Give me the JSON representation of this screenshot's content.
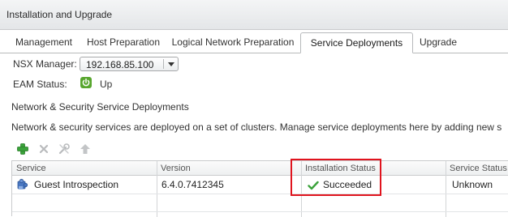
{
  "window": {
    "title": "Installation and Upgrade"
  },
  "tabs": [
    {
      "label": "Management",
      "active": false
    },
    {
      "label": "Host Preparation",
      "active": false
    },
    {
      "label": "Logical Network Preparation",
      "active": false
    },
    {
      "label": "Service Deployments",
      "active": true
    },
    {
      "label": "Upgrade",
      "active": false
    }
  ],
  "nsx_manager": {
    "label": "NSX Manager:",
    "selected": "192.168.85.100"
  },
  "eam": {
    "label": "EAM Status:",
    "status": "Up",
    "status_icon": "power-icon",
    "status_color": "#58a62e"
  },
  "section": {
    "title": "Network & Security Service Deployments",
    "description": "Network & security services are deployed on a set of clusters. Manage service deployments here by adding new s"
  },
  "toolbar": {
    "icons": [
      "add-icon",
      "remove-icon",
      "tools-icon",
      "upgrade-icon"
    ]
  },
  "table": {
    "columns": [
      "Service",
      "Version",
      "Installation Status",
      "Service Status"
    ],
    "rows": [
      {
        "service": "Guest Introspection",
        "service_icon": "puzzle-icon",
        "version": "6.4.0.7412345",
        "installation_status": "Succeeded",
        "installation_status_icon": "check-icon",
        "service_status": "Unknown"
      }
    ]
  },
  "colors": {
    "highlight_box": "#e0141e",
    "add_icon": "#3aa23a",
    "success_check": "#3aa23a"
  }
}
